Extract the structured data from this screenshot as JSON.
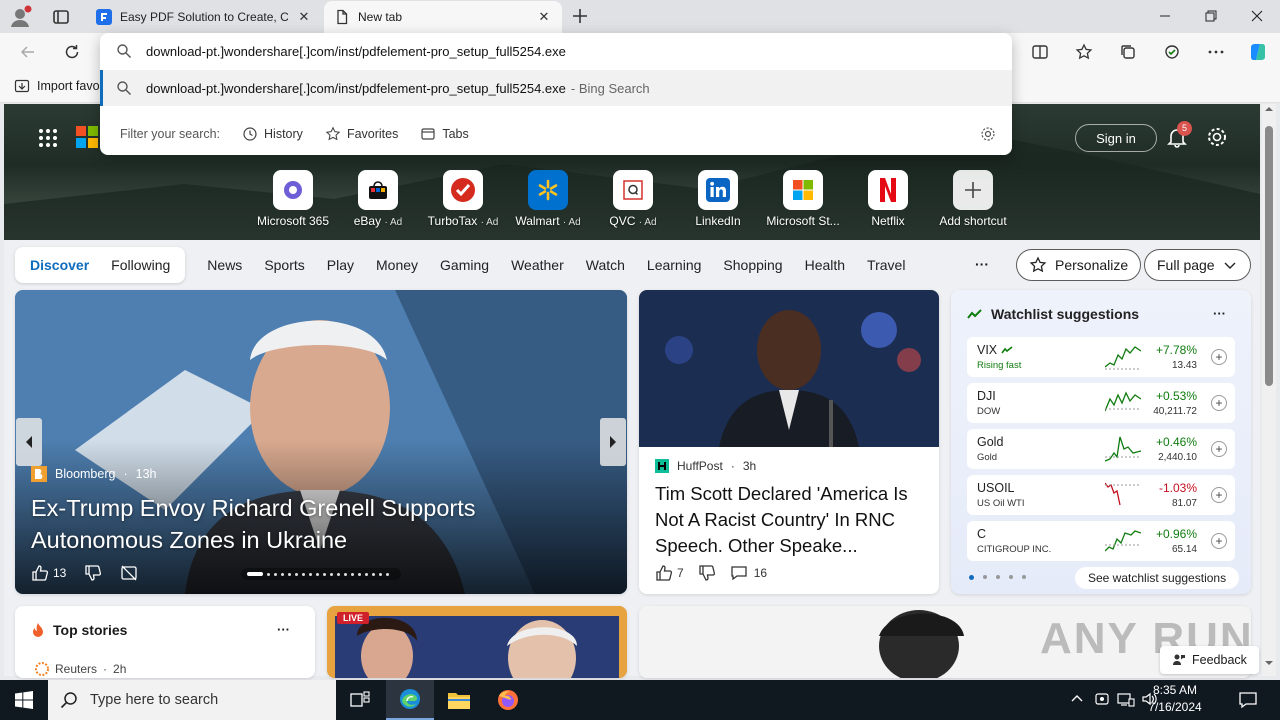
{
  "tabs": [
    {
      "title": "Easy PDF Solution to Create, Con",
      "icon": "pdfelement-icon",
      "active": false
    },
    {
      "title": "New tab",
      "icon": "page-icon",
      "active": true
    }
  ],
  "omnibox": {
    "input_value": "download-pt.]wondershare[.]com/inst/pdfelement-pro_setup_full5254.exe",
    "suggestion": "download-pt.]wondershare[.]com/inst/pdfelement-pro_setup_full5254.exe",
    "suggestion_hint": "- Bing Search",
    "filter_label": "Filter your search:",
    "filters": [
      "History",
      "Favorites",
      "Tabs"
    ]
  },
  "favbar": {
    "import": "Import favo"
  },
  "header": {
    "sign_in": "Sign in",
    "notif_count": "5"
  },
  "shortcuts": [
    {
      "label": "Microsoft 365",
      "ad": ""
    },
    {
      "label": "eBay",
      "ad": "Ad"
    },
    {
      "label": "TurboTax",
      "ad": "Ad"
    },
    {
      "label": "Walmart",
      "ad": "Ad"
    },
    {
      "label": "QVC",
      "ad": "Ad"
    },
    {
      "label": "LinkedIn",
      "ad": ""
    },
    {
      "label": "Microsoft St...",
      "ad": ""
    },
    {
      "label": "Netflix",
      "ad": ""
    },
    {
      "label": "Add shortcut",
      "ad": ""
    }
  ],
  "nav": {
    "discover": "Discover",
    "following": "Following",
    "items": [
      "News",
      "Sports",
      "Play",
      "Money",
      "Gaming",
      "Weather",
      "Watch",
      "Learning",
      "Shopping",
      "Health",
      "Travel"
    ],
    "more": "···",
    "personalize": "Personalize",
    "full_page": "Full page"
  },
  "hero_story": {
    "source": "Bloomberg",
    "age": "13h",
    "headline": "Ex-Trump Envoy Richard Grenell Supports Autonomous Zones in Ukraine",
    "likes": "13"
  },
  "story2": {
    "source": "HuffPost",
    "age": "3h",
    "headline": "Tim Scott Declared 'America Is Not A Racist Country' In RNC Speech. Other Speake...",
    "likes": "7",
    "comments": "16"
  },
  "watchlist": {
    "title": "Watchlist suggestions",
    "more": "···",
    "rows": [
      {
        "sym": "VIX",
        "sub": "Rising fast",
        "chg": "+7.78%",
        "price": "13.43",
        "up": true
      },
      {
        "sym": "DJI",
        "sub": "DOW",
        "chg": "+0.53%",
        "price": "40,211.72",
        "up": true
      },
      {
        "sym": "Gold",
        "sub": "Gold",
        "chg": "+0.46%",
        "price": "2,440.10",
        "up": true
      },
      {
        "sym": "USOIL",
        "sub": "US Oil WTI",
        "chg": "-1.03%",
        "price": "81.07",
        "up": false
      },
      {
        "sym": "C",
        "sub": "CITIGROUP INC.",
        "chg": "+0.96%",
        "price": "65.14",
        "up": true
      }
    ],
    "see_more": "See watchlist suggestions"
  },
  "top_stories": {
    "title": "Top stories",
    "more": "···",
    "source": "Reuters",
    "age": "2h"
  },
  "thumb_badge": "LIVE",
  "feedback": "Feedback",
  "watermark": "ANY RUN",
  "taskbar": {
    "search_placeholder": "Type here to search",
    "time": "8:35 AM",
    "date": "7/16/2024"
  },
  "colors": {
    "accent": "#0f6cbd",
    "up": "#107c10",
    "down": "#c50f1f"
  }
}
